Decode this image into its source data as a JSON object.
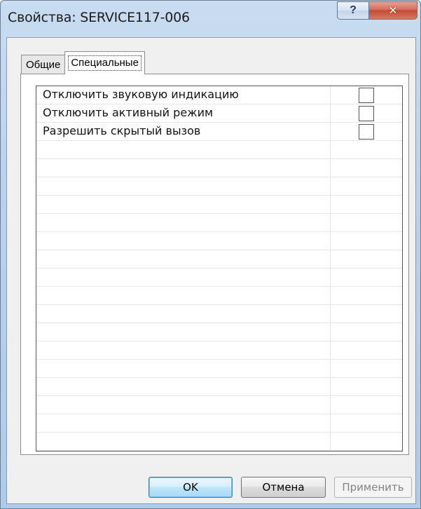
{
  "window": {
    "title": "Свойства: SERVICE117-006",
    "help_glyph": "?",
    "close_glyph": "✕"
  },
  "tabs": [
    {
      "label": "Общие",
      "active": false
    },
    {
      "label": "Специальные",
      "active": true
    }
  ],
  "properties": [
    {
      "label": "Отключить звуковую индикацию",
      "checked": false
    },
    {
      "label": "Отключить активный режим",
      "checked": false
    },
    {
      "label": "Разрешить скрытый вызов",
      "checked": false
    }
  ],
  "buttons": {
    "ok": "OK",
    "cancel": "Отмена",
    "apply": "Применить"
  },
  "colors": {
    "title_bar": "#b9d1ec",
    "close_button": "#c24c36",
    "dialog_background": "#f0f0f0",
    "default_button_border": "#3c7fb1",
    "disabled_text": "#838383"
  }
}
